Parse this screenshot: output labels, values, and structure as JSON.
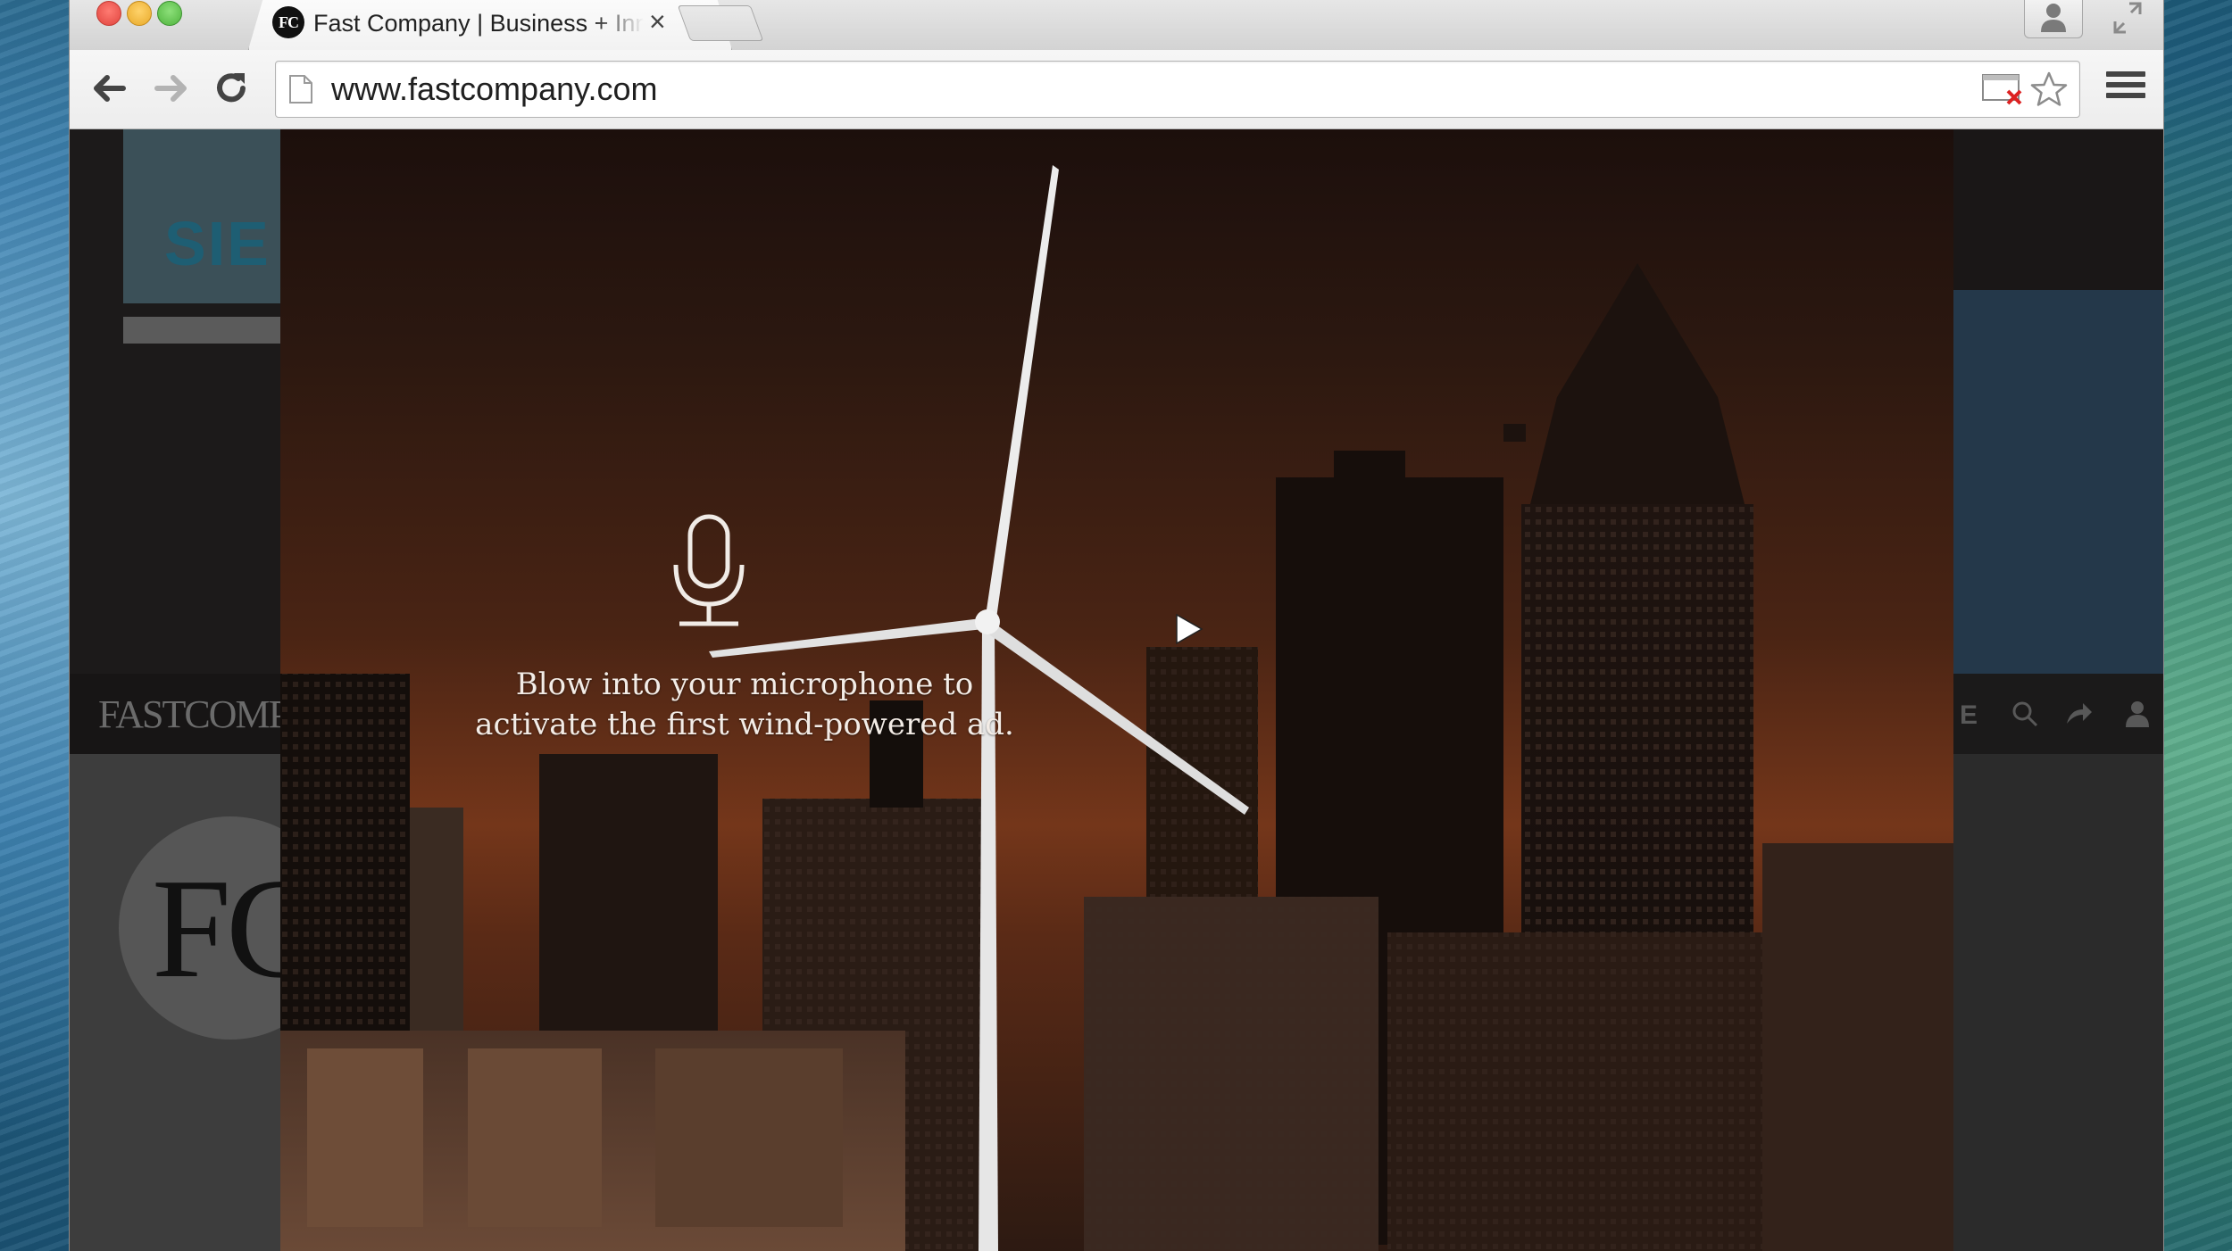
{
  "browser": {
    "tab": {
      "favicon_text": "FC",
      "title": "Fast Company | Business + Innovation",
      "close_glyph": "×"
    },
    "toolbar": {
      "url": "www.fastcompany.com",
      "back_icon": "back-arrow-icon",
      "forward_icon": "forward-arrow-icon",
      "reload_icon": "reload-icon",
      "bookmark_icon": "star-icon",
      "menu_icon": "hamburger-menu-icon",
      "popup_blocked_icon": "popup-blocked-icon"
    }
  },
  "site": {
    "sponsor_partial": "SIE",
    "logo_partial": "FASTCOMPAN",
    "circle_logo_partial": "FC",
    "right_nav_partial": "E"
  },
  "ad": {
    "mic_icon": "microphone-icon",
    "message_line1": "Blow into your microphone to",
    "message_line2": "activate the first wind-powered ad."
  },
  "colors": {
    "ad_sky_top": "#1c0f0c",
    "ad_sky_glow": "#74361a",
    "turbine": "#e8e8e8"
  }
}
